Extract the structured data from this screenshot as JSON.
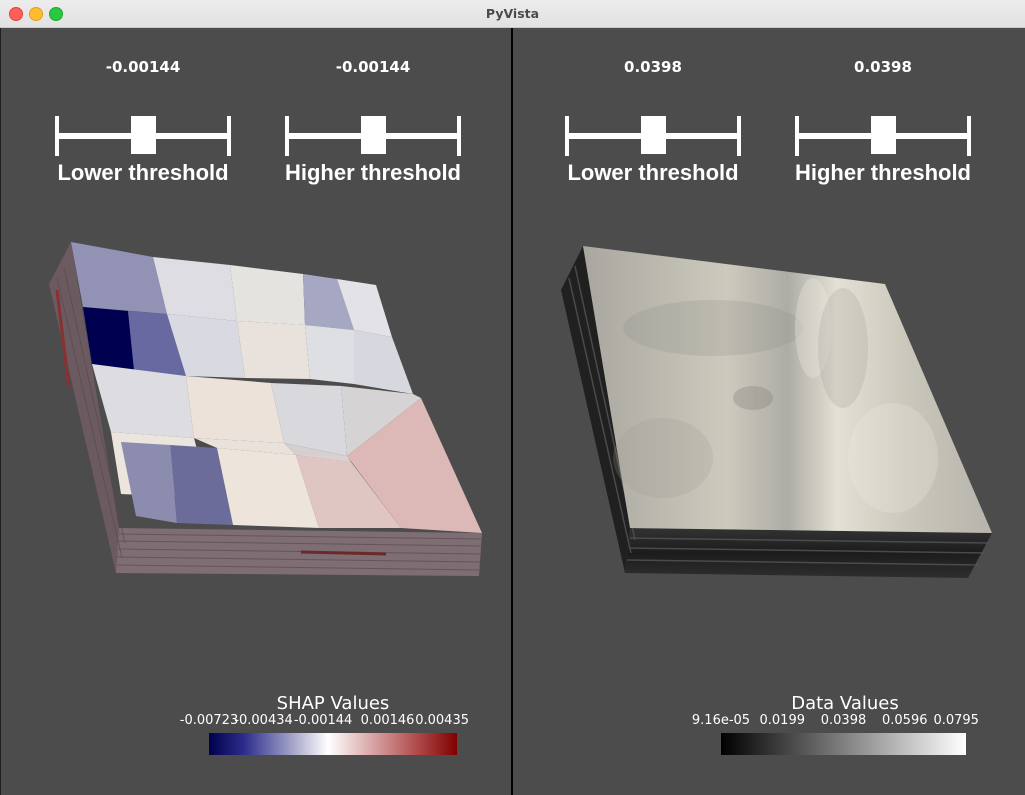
{
  "window": {
    "title": "PyVista"
  },
  "colors": {
    "background": "#4c4c4c",
    "cmap_low": "#00004c",
    "cmap_mid": "#ffffff",
    "cmap_high": "#800000"
  },
  "left_view": {
    "sliders": [
      {
        "value": "-0.00144",
        "label": "Lower threshold"
      },
      {
        "value": "-0.00144",
        "label": "Higher threshold"
      }
    ],
    "scalar_bar": {
      "title": "SHAP Values",
      "ticks": [
        "-0.00723",
        "-0.00434",
        "-0.00144",
        "0.00146",
        "0.00435"
      ]
    }
  },
  "right_view": {
    "sliders": [
      {
        "value": "0.0398",
        "label": "Lower threshold"
      },
      {
        "value": "0.0398",
        "label": "Higher threshold"
      }
    ],
    "scalar_bar": {
      "title": "Data Values",
      "ticks": [
        "9.16e-05",
        "0.0199",
        "0.0398",
        "0.0596",
        "0.0795"
      ]
    }
  }
}
